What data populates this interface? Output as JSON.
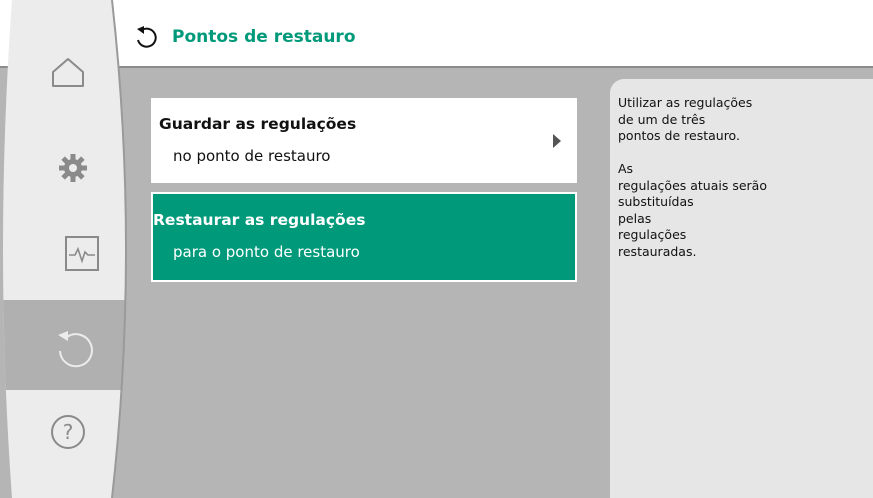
{
  "header": {
    "title": "Pontos de restauro",
    "icon": "restore-icon",
    "title_color": "#009a7b"
  },
  "menu": {
    "items": [
      {
        "title": "Guardar as regulações",
        "subtitle": "no ponto de restauro",
        "selected": false
      },
      {
        "title": "Restaurar as regulações",
        "subtitle": "para o ponto de restauro",
        "selected": true
      }
    ]
  },
  "info": {
    "text": "Utilizar as regulações\nde um de três\npontos de restauro.\n\nAs\nregulações atuais serão\nsubstituídas\npelas\nregulações\nrestauradas."
  },
  "nav": {
    "items": [
      {
        "icon": "home-icon",
        "active": false
      },
      {
        "icon": "gear-icon",
        "active": false
      },
      {
        "icon": "diagnostics-icon",
        "active": false
      },
      {
        "icon": "restore-icon",
        "active": true
      },
      {
        "icon": "help-icon",
        "active": false
      }
    ]
  },
  "colors": {
    "accent": "#009a7b",
    "nav_bg": "#ececec",
    "nav_active": "#b0b0b0",
    "main_bg": "#b5b5b5",
    "panel_bg": "#e6e6e6"
  }
}
